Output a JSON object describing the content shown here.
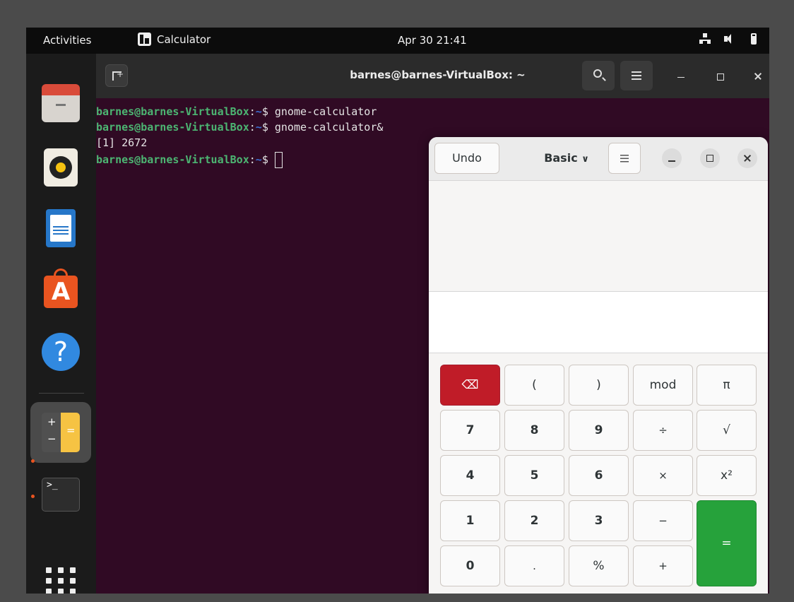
{
  "topbar": {
    "activities": "Activities",
    "app_name": "Calculator",
    "clock": "Apr 30  21:41"
  },
  "dock": {
    "items": [
      "files",
      "rhythmbox",
      "libreoffice-writer",
      "ubuntu-software",
      "help",
      "calculator",
      "terminal",
      "show-applications"
    ],
    "calc_plus": "+",
    "calc_minus": "−",
    "calc_equals": "=",
    "terminal_prompt": ">_"
  },
  "terminal": {
    "title": "barnes@barnes-VirtualBox: ~",
    "prompt_user": "barnes@barnes-VirtualBox",
    "prompt_sep": ":",
    "prompt_path": "~",
    "prompt_dollar": "$ ",
    "lines": [
      {
        "type": "cmd",
        "command": "gnome-calculator"
      },
      {
        "type": "cmd",
        "command": "gnome-calculator&"
      },
      {
        "type": "output",
        "text": "[1] 2672"
      },
      {
        "type": "cmd",
        "command": ""
      }
    ]
  },
  "calculator": {
    "undo_label": "Undo",
    "mode_label": "Basic",
    "mode_chevron": "⌄",
    "display_value": "",
    "keys": [
      [
        "⌫",
        "(",
        ")",
        "mod",
        "π"
      ],
      [
        "7",
        "8",
        "9",
        "÷",
        "√"
      ],
      [
        "4",
        "5",
        "6",
        "×",
        "x²"
      ],
      [
        "1",
        "2",
        "3",
        "−",
        "="
      ],
      [
        "0",
        ".",
        "%",
        "+"
      ]
    ]
  },
  "colors": {
    "terminal_bg": "#300a24",
    "prompt_user": "#4cb572",
    "prompt_path": "#3c6fd1",
    "backspace_key": "#c01c28",
    "equals_key": "#26a23b"
  }
}
